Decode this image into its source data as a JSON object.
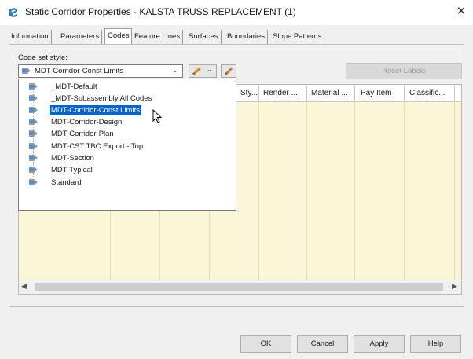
{
  "window": {
    "title": "Static Corridor Properties - KALSTA TRUSS REPLACEMENT (1)",
    "close_glyph": "✕"
  },
  "tabs": [
    {
      "label": "Information",
      "active": false
    },
    {
      "label": "Parameters",
      "active": false
    },
    {
      "label": "Codes",
      "active": true
    },
    {
      "label": "Feature Lines",
      "active": false
    },
    {
      "label": "Surfaces",
      "active": false
    },
    {
      "label": "Boundaries",
      "active": false
    },
    {
      "label": "Slope Patterns",
      "active": false
    }
  ],
  "codeset": {
    "label": "Code set style:",
    "selected": "MDT-Corridor-Const Limits",
    "reset_label": "Reset Labels",
    "options": [
      "_MDT-Default",
      "_MDT-Subassembly All Codes",
      "MDT-Corridor-Const Limits",
      "MDT-Corridor-Design",
      "MDT-Corridor-Plan",
      "MDT-CST TBC Export - Top",
      "MDT-Section",
      "MDT-Typical",
      "Standard"
    ],
    "selected_index": 2
  },
  "grid": {
    "columns": [
      "Sty...",
      "Render ...",
      "Material ...",
      "Pay Item",
      "Classific..."
    ]
  },
  "buttons": {
    "ok": "OK",
    "cancel": "Cancel",
    "apply": "Apply",
    "help": "Help"
  },
  "colors": {
    "selection": "#0a64c8",
    "grid_background": "#fbf6d8",
    "app_icon": "#2a7fb8"
  },
  "icons": {
    "app": "civil3d-app-icon",
    "style": "code-set-style-icon",
    "edit": "edit-style-icon",
    "pick": "pick-style-icon",
    "scroll_left": "◀",
    "scroll_right": "▶",
    "chevron": "⌄"
  }
}
